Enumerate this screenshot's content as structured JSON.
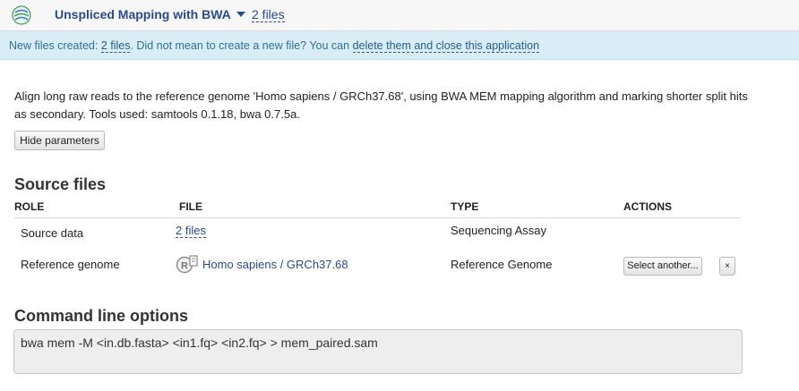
{
  "header": {
    "app_title": "Unspliced Mapping with BWA",
    "files_link": "2 files"
  },
  "notice": {
    "prefix": "New files created: ",
    "files_link": "2 files",
    "middle": ". Did not mean to create a new file? You can ",
    "delete_link": "delete them and close this application"
  },
  "description": "Align long raw reads to the reference genome 'Homo sapiens / GRCh37.68', using BWA MEM mapping algorithm and marking shorter split hits as secondary. Tools used: samtools 0.1.18, bwa 0.7.5a.",
  "hide_params_label": "Hide parameters",
  "source_files": {
    "title": "Source files",
    "columns": [
      "ROLE",
      "FILE",
      "TYPE",
      "ACTIONS"
    ],
    "rows": [
      {
        "role": "Source data",
        "file": "2 files",
        "type": "Sequencing Assay"
      },
      {
        "role": "Reference genome",
        "file": "Homo sapiens / GRCh37.68",
        "file_icon": "reference-genome-icon",
        "type": "Reference Genome",
        "select_label": "Select another...",
        "clear_label": "×"
      }
    ]
  },
  "command_line": {
    "title": "Command line options",
    "value": "bwa mem -M <in.db.fasta> <in1.fq> <in2.fq> > mem_paired.sam"
  },
  "colors": {
    "link": "#2b4a8a",
    "notice_bg": "#d9edf7",
    "notice_text": "#31708f"
  }
}
